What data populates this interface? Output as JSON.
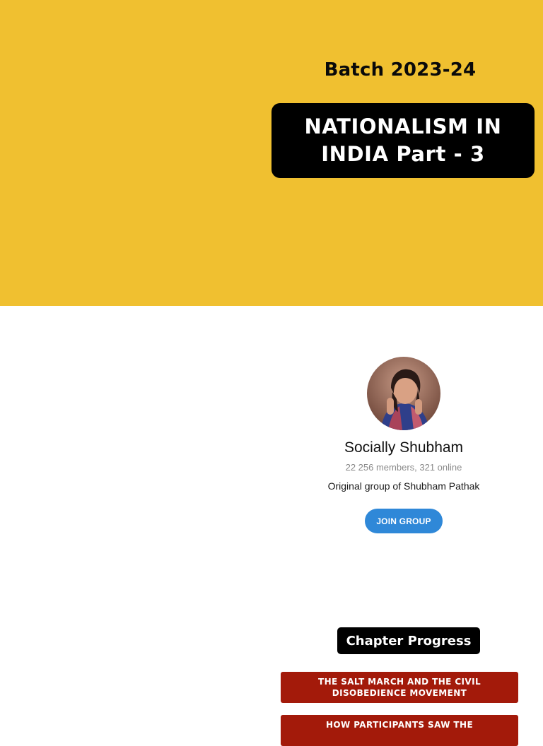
{
  "hero": {
    "batch_label": "Batch 2023-24",
    "title": "NATIONALISM IN INDIA Part - 3",
    "background_color": "#f0c030"
  },
  "group": {
    "avatar_icon": "profile-photo",
    "name": "Socially Shubham",
    "members": "22 256 members, 321 online",
    "description": "Original group of Shubham Pathak",
    "join_label": "JOIN GROUP",
    "accent_color": "#2f88d8"
  },
  "progress": {
    "heading": "Chapter Progress",
    "chapters": [
      {
        "label": "THE SALT MARCH AND THE CIVIL DISOBEDIENCE MOVEMENT"
      },
      {
        "label": "HOW PARTICIPANTS SAW THE"
      }
    ],
    "chapter_color": "#a31a0a"
  }
}
